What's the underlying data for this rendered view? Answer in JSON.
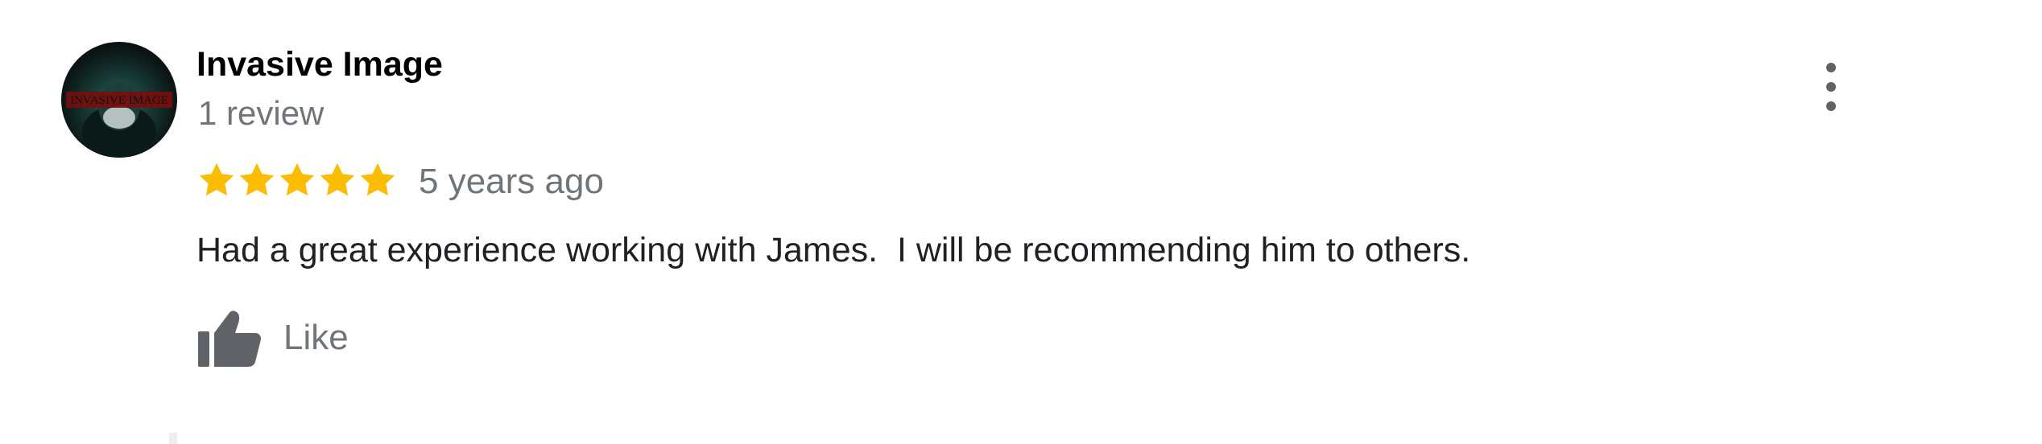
{
  "review": {
    "reviewer_name": "Invasive Image",
    "review_count": "1 review",
    "rating": 5,
    "rating_max": 5,
    "date": "5 years ago",
    "text": "Had a great experience working with James.  I will be recommending him to others.",
    "like_label": "Like",
    "avatar_text": "INVASIVE IMAGE"
  },
  "icons": {
    "star": "star-icon",
    "like": "thumbs-up-icon",
    "more": "more-vert-icon"
  },
  "colors": {
    "star": "#FBBC04",
    "secondary_text": "#70757a",
    "icon": "#5f6368"
  }
}
